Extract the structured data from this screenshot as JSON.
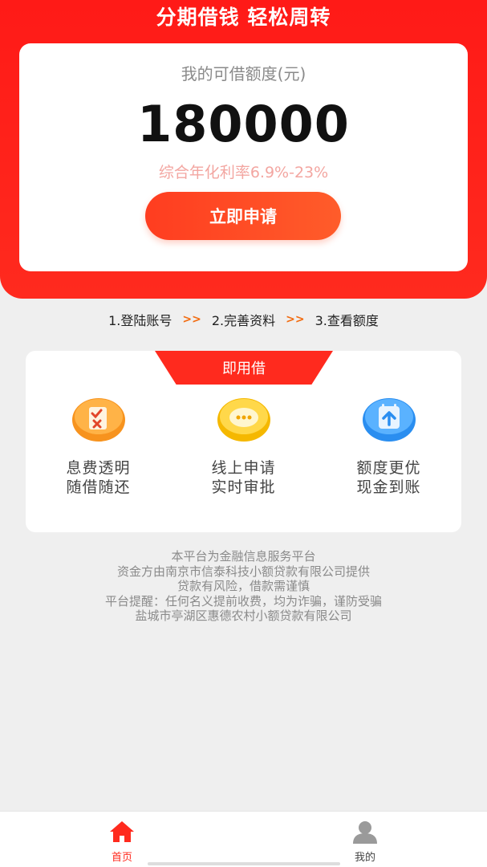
{
  "hero": {
    "title": "分期借钱 轻松周转"
  },
  "quota": {
    "label": "我的可借额度(元)",
    "amount": "180000",
    "rate": "综合年化利率6.9%-23%",
    "apply_button": "立即申请"
  },
  "steps": {
    "items": [
      "1.登陆账号",
      "2.完善资料",
      "3.查看额度"
    ],
    "separator": ">>"
  },
  "features": {
    "tab_label": "即用借",
    "items": [
      {
        "icon": "checklist-icon",
        "line1": "息费透明",
        "line2": "随借随还"
      },
      {
        "icon": "chat-bubble-icon",
        "line1": "线上申请",
        "line2": "实时审批"
      },
      {
        "icon": "upload-calendar-icon",
        "line1": "额度更优",
        "line2": "现金到账"
      }
    ]
  },
  "disclaimer": {
    "lines": [
      "本平台为金融信息服务平台",
      "资金方由南京市信泰科技小额贷款有限公司提供",
      "贷款有风险，借款需谨慎",
      "平台提醒：任何名义提前收费，均为诈骗，谨防受骗",
      "盐城市亭湖区惠德农村小额贷款有限公司"
    ]
  },
  "tabbar": {
    "home": "首页",
    "mine": "我的"
  },
  "colors": {
    "brand_red": "#ff2a1e",
    "step_arrow": "#f26b0f",
    "rate_pink": "#f3a6a1"
  }
}
